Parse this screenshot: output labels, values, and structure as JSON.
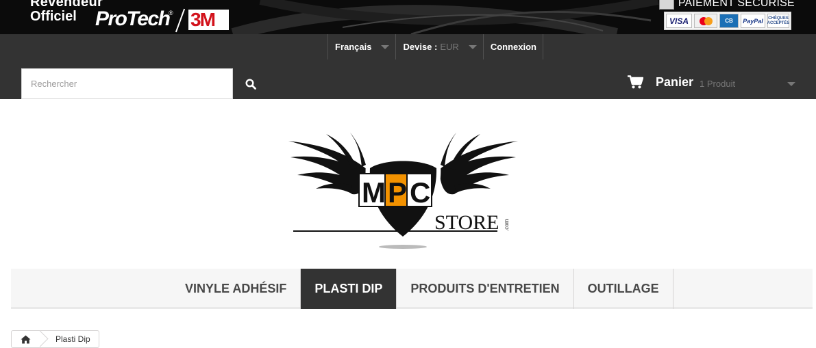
{
  "banner": {
    "reseller_line1": "Revendeur",
    "reseller_line2": "Officiel",
    "brand_protech": "ProTech",
    "brand_protech_mark": "®",
    "brand_3m": "3M",
    "payment_title": "PAIEMENT SÉCURISÉ",
    "cards": {
      "visa": "VISA",
      "mastercard": "MasterCard",
      "cb": "CB",
      "paypal": "PayPal",
      "cheques": "CHÈQUES ACCEPTÉS"
    }
  },
  "nav": {
    "language": "Français",
    "currency_label": "Devise :",
    "currency_value": "EUR",
    "login": "Connexion"
  },
  "search": {
    "placeholder": "Rechercher"
  },
  "cart": {
    "label": "Panier",
    "count": "1 Produit"
  },
  "logo": {
    "letters": "MPC",
    "store": "STORE",
    "tld": ".com"
  },
  "menu": {
    "items": [
      {
        "label": "VINYLE ADHÉSIF",
        "active": false
      },
      {
        "label": "PLASTI DIP",
        "active": true
      },
      {
        "label": "PRODUITS D'ENTRETIEN",
        "active": false
      },
      {
        "label": "OUTILLAGE",
        "active": false
      }
    ]
  },
  "breadcrumb": {
    "home_icon": "home-icon",
    "current": "Plasti Dip"
  },
  "colors": {
    "nav_bg": "#333333",
    "banner_bg": "#0b0b0b",
    "menu_bg": "#f6f6f6",
    "accent_orange": "#f39200"
  }
}
